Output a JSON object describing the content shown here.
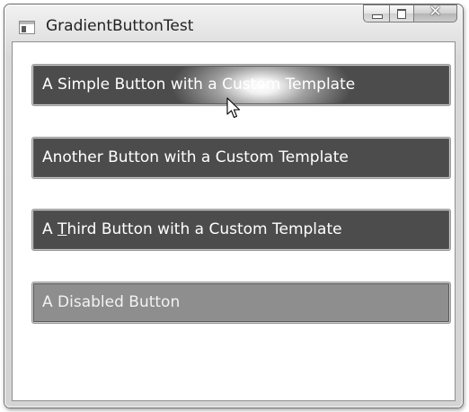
{
  "window": {
    "title": "GradientButtonTest"
  },
  "caption_buttons": {
    "minimize_icon": "minimize-icon",
    "maximize_icon": "maximize-icon",
    "close_glyph": "✕"
  },
  "buttons": [
    {
      "label": "A Simple Button with a Custom Template",
      "state": "hover"
    },
    {
      "label": "Another Button with a Custom Template",
      "state": "normal"
    },
    {
      "label_prefix": "A ",
      "label_access_key": "T",
      "label_suffix": "hird Button with a Custom Template",
      "state": "normal"
    },
    {
      "label": "A Disabled Button",
      "state": "disabled"
    }
  ],
  "colors": {
    "button_fill": "#4c4c4c",
    "button_disabled_fill": "#8e8e8e",
    "button_text": "#ffffff"
  }
}
